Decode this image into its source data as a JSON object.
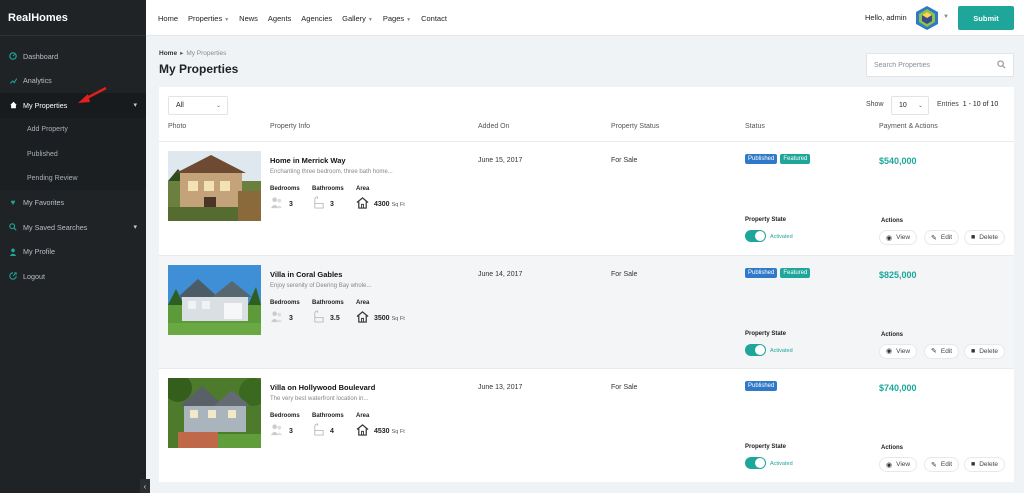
{
  "brand": "RealHomes",
  "sidebar": {
    "items": [
      {
        "label": "Dashboard",
        "icon": "dashboard-icon"
      },
      {
        "label": "Analytics",
        "icon": "analytics-icon"
      },
      {
        "label": "My Properties",
        "icon": "home-icon",
        "active": true
      },
      {
        "label": "My Favorites",
        "icon": "heart-icon"
      },
      {
        "label": "My Saved Searches",
        "icon": "search-icon"
      },
      {
        "label": "My Profile",
        "icon": "user-icon"
      },
      {
        "label": "Logout",
        "icon": "logout-icon"
      }
    ],
    "subitems": [
      "Add Property",
      "Published",
      "Pending Review"
    ],
    "accent": "#1ea69a",
    "annotation_arrow_color": "#e0201b"
  },
  "header": {
    "menu": [
      "Home",
      "Properties",
      "News",
      "Agents",
      "Agencies",
      "Gallery",
      "Pages",
      "Contact"
    ],
    "greeting": "Hello, admin",
    "submit_label": "Submit"
  },
  "breadcrumb": {
    "home": "Home",
    "current": "My Properties"
  },
  "page_title": "My Properties",
  "search": {
    "placeholder": "Search Properties"
  },
  "toolbar": {
    "filter_value": "All",
    "show_label": "Show",
    "show_value": "10",
    "entries_label": "Entries",
    "range": "1 - 10 of 10"
  },
  "columns": [
    "Photo",
    "Property Info",
    "Added On",
    "Property Status",
    "Status",
    "Payment & Actions"
  ],
  "labels": {
    "bedrooms": "Bedrooms",
    "bathrooms": "Bathrooms",
    "area": "Area",
    "property_state": "Property State",
    "actions": "Actions",
    "view": "View",
    "edit": "Edit",
    "delete": "Delete"
  },
  "properties": [
    {
      "title": "Home in Merrick Way",
      "desc": "Enchanting three bedroom, three bath home...",
      "bedrooms": "3",
      "bathrooms": "3",
      "area": "4300",
      "area_unit": "Sq Ft",
      "added": "June 15, 2017",
      "status": "For Sale",
      "badges": [
        "Published",
        "Featured"
      ],
      "price": "$540,000",
      "state": "Activated"
    },
    {
      "title": "Villa in Coral Gables",
      "desc": "Enjoy serenity of Deering Bay whole...",
      "bedrooms": "3",
      "bathrooms": "3.5",
      "area": "3500",
      "area_unit": "Sq Ft",
      "added": "June 14, 2017",
      "status": "For Sale",
      "badges": [
        "Published",
        "Featured"
      ],
      "price": "$825,000",
      "state": "Activated"
    },
    {
      "title": "Villa on Hollywood Boulevard",
      "desc": "The very best waterfront location in...",
      "bedrooms": "3",
      "bathrooms": "4",
      "area": "4530",
      "area_unit": "Sq Ft",
      "added": "June 13, 2017",
      "status": "For Sale",
      "badges": [
        "Published"
      ],
      "price": "$740,000",
      "state": "Activated"
    }
  ]
}
